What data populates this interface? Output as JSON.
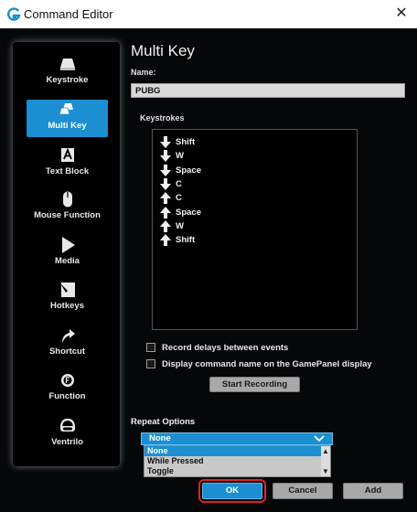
{
  "window": {
    "title": "Command Editor",
    "close_glyph": "✕"
  },
  "sidebar": {
    "items": [
      {
        "label": "Keystroke",
        "icon": "keyboard-key-icon"
      },
      {
        "label": "Multi Key",
        "icon": "multi-key-icon",
        "active": true
      },
      {
        "label": "Text Block",
        "icon": "text-block-icon"
      },
      {
        "label": "Mouse Function",
        "icon": "mouse-icon"
      },
      {
        "label": "Media",
        "icon": "play-icon"
      },
      {
        "label": "Hotkeys",
        "icon": "hotkeys-icon"
      },
      {
        "label": "Shortcut",
        "icon": "shortcut-arrow-icon"
      },
      {
        "label": "Function",
        "icon": "function-gear-icon"
      },
      {
        "label": "Ventrilo",
        "icon": "headset-icon"
      }
    ]
  },
  "main": {
    "heading": "Multi Key",
    "name_label": "Name:",
    "name_value": "PUBG",
    "keystrokes_label": "Keystrokes",
    "keystrokes": [
      {
        "direction": "down",
        "key": "Shift"
      },
      {
        "direction": "down",
        "key": "W"
      },
      {
        "direction": "down",
        "key": "Space"
      },
      {
        "direction": "down",
        "key": "C"
      },
      {
        "direction": "up",
        "key": "C"
      },
      {
        "direction": "up",
        "key": "Space"
      },
      {
        "direction": "up",
        "key": "W"
      },
      {
        "direction": "up",
        "key": "Shift"
      }
    ],
    "record_delays_label": "Record delays between events",
    "display_name_label": "Display command name on the GamePanel display",
    "start_recording_label": "Start Recording"
  },
  "repeat": {
    "label": "Repeat Options",
    "selected": "None",
    "options": [
      "None",
      "While Pressed",
      "Toggle"
    ]
  },
  "footer": {
    "ok_label": "OK",
    "cancel_label": "Cancel",
    "add_label": "Add"
  },
  "colors": {
    "accent": "#1b8fd2",
    "highlight_border": "#e0202a",
    "background": "#050708"
  }
}
